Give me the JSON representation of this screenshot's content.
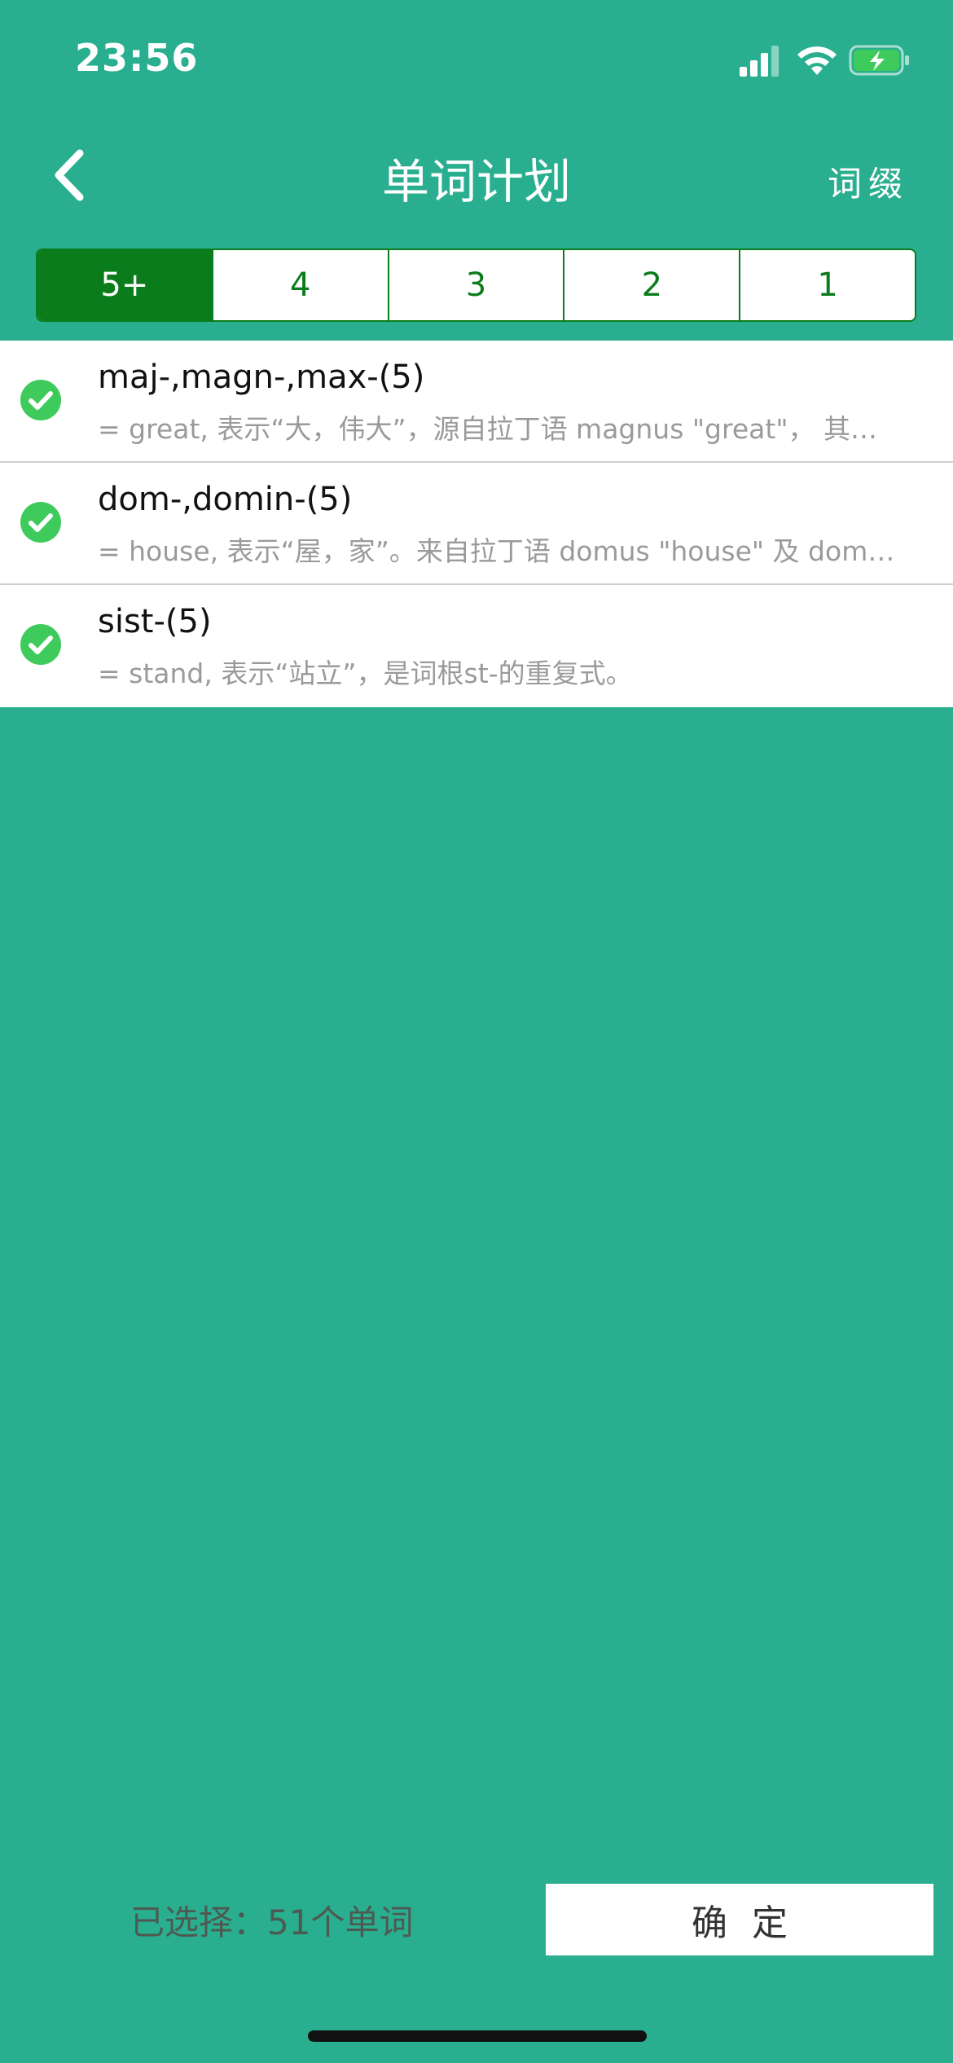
{
  "status_bar": {
    "time": "23:56",
    "icons": [
      "signal-icon",
      "wifi-icon",
      "battery-charging-icon"
    ]
  },
  "nav": {
    "back_icon": "chevron-left-icon",
    "title": "单词计划",
    "right_label": "词缀"
  },
  "segments": {
    "items": [
      {
        "label": "5+",
        "active": true
      },
      {
        "label": "4",
        "active": false
      },
      {
        "label": "3",
        "active": false
      },
      {
        "label": "2",
        "active": false
      },
      {
        "label": "1",
        "active": false
      }
    ]
  },
  "list": {
    "items": [
      {
        "title": "maj-,magn-,max-(5)",
        "desc": "= great, 表示“大，伟大”，源自拉丁语 magnus \"great\"， 其…",
        "checked": true
      },
      {
        "title": "dom-,domin-(5)",
        "desc": "= house, 表示“屋，家”。来自拉丁语 domus \"house\" 及 dom…",
        "checked": true
      },
      {
        "title": "sist-(5)",
        "desc": "= stand, 表示“站立”，是词根st-的重复式。",
        "checked": true
      }
    ]
  },
  "footer": {
    "selected_text": "已选择：51个单词",
    "confirm_label": "确定"
  },
  "colors": {
    "background": "#29AF8F",
    "segment_active": "#0b7c1c",
    "check": "#3ecb5c"
  }
}
